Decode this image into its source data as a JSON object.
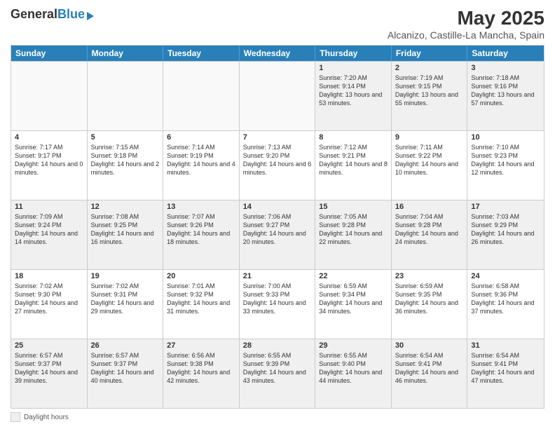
{
  "header": {
    "logo_general": "General",
    "logo_blue": "Blue",
    "title": "May 2025",
    "subtitle": "Alcanizo, Castille-La Mancha, Spain"
  },
  "days_of_week": [
    "Sunday",
    "Monday",
    "Tuesday",
    "Wednesday",
    "Thursday",
    "Friday",
    "Saturday"
  ],
  "weeks": [
    [
      {
        "day": "",
        "empty": true
      },
      {
        "day": "",
        "empty": true
      },
      {
        "day": "",
        "empty": true
      },
      {
        "day": "",
        "empty": true
      },
      {
        "day": "1",
        "sunrise": "Sunrise: 7:20 AM",
        "sunset": "Sunset: 9:14 PM",
        "daylight": "Daylight: 13 hours and 53 minutes."
      },
      {
        "day": "2",
        "sunrise": "Sunrise: 7:19 AM",
        "sunset": "Sunset: 9:15 PM",
        "daylight": "Daylight: 13 hours and 55 minutes."
      },
      {
        "day": "3",
        "sunrise": "Sunrise: 7:18 AM",
        "sunset": "Sunset: 9:16 PM",
        "daylight": "Daylight: 13 hours and 57 minutes."
      }
    ],
    [
      {
        "day": "4",
        "sunrise": "Sunrise: 7:17 AM",
        "sunset": "Sunset: 9:17 PM",
        "daylight": "Daylight: 14 hours and 0 minutes."
      },
      {
        "day": "5",
        "sunrise": "Sunrise: 7:15 AM",
        "sunset": "Sunset: 9:18 PM",
        "daylight": "Daylight: 14 hours and 2 minutes."
      },
      {
        "day": "6",
        "sunrise": "Sunrise: 7:14 AM",
        "sunset": "Sunset: 9:19 PM",
        "daylight": "Daylight: 14 hours and 4 minutes."
      },
      {
        "day": "7",
        "sunrise": "Sunrise: 7:13 AM",
        "sunset": "Sunset: 9:20 PM",
        "daylight": "Daylight: 14 hours and 6 minutes."
      },
      {
        "day": "8",
        "sunrise": "Sunrise: 7:12 AM",
        "sunset": "Sunset: 9:21 PM",
        "daylight": "Daylight: 14 hours and 8 minutes."
      },
      {
        "day": "9",
        "sunrise": "Sunrise: 7:11 AM",
        "sunset": "Sunset: 9:22 PM",
        "daylight": "Daylight: 14 hours and 10 minutes."
      },
      {
        "day": "10",
        "sunrise": "Sunrise: 7:10 AM",
        "sunset": "Sunset: 9:23 PM",
        "daylight": "Daylight: 14 hours and 12 minutes."
      }
    ],
    [
      {
        "day": "11",
        "sunrise": "Sunrise: 7:09 AM",
        "sunset": "Sunset: 9:24 PM",
        "daylight": "Daylight: 14 hours and 14 minutes."
      },
      {
        "day": "12",
        "sunrise": "Sunrise: 7:08 AM",
        "sunset": "Sunset: 9:25 PM",
        "daylight": "Daylight: 14 hours and 16 minutes."
      },
      {
        "day": "13",
        "sunrise": "Sunrise: 7:07 AM",
        "sunset": "Sunset: 9:26 PM",
        "daylight": "Daylight: 14 hours and 18 minutes."
      },
      {
        "day": "14",
        "sunrise": "Sunrise: 7:06 AM",
        "sunset": "Sunset: 9:27 PM",
        "daylight": "Daylight: 14 hours and 20 minutes."
      },
      {
        "day": "15",
        "sunrise": "Sunrise: 7:05 AM",
        "sunset": "Sunset: 9:28 PM",
        "daylight": "Daylight: 14 hours and 22 minutes."
      },
      {
        "day": "16",
        "sunrise": "Sunrise: 7:04 AM",
        "sunset": "Sunset: 9:28 PM",
        "daylight": "Daylight: 14 hours and 24 minutes."
      },
      {
        "day": "17",
        "sunrise": "Sunrise: 7:03 AM",
        "sunset": "Sunset: 9:29 PM",
        "daylight": "Daylight: 14 hours and 26 minutes."
      }
    ],
    [
      {
        "day": "18",
        "sunrise": "Sunrise: 7:02 AM",
        "sunset": "Sunset: 9:30 PM",
        "daylight": "Daylight: 14 hours and 27 minutes."
      },
      {
        "day": "19",
        "sunrise": "Sunrise: 7:02 AM",
        "sunset": "Sunset: 9:31 PM",
        "daylight": "Daylight: 14 hours and 29 minutes."
      },
      {
        "day": "20",
        "sunrise": "Sunrise: 7:01 AM",
        "sunset": "Sunset: 9:32 PM",
        "daylight": "Daylight: 14 hours and 31 minutes."
      },
      {
        "day": "21",
        "sunrise": "Sunrise: 7:00 AM",
        "sunset": "Sunset: 9:33 PM",
        "daylight": "Daylight: 14 hours and 33 minutes."
      },
      {
        "day": "22",
        "sunrise": "Sunrise: 6:59 AM",
        "sunset": "Sunset: 9:34 PM",
        "daylight": "Daylight: 14 hours and 34 minutes."
      },
      {
        "day": "23",
        "sunrise": "Sunrise: 6:59 AM",
        "sunset": "Sunset: 9:35 PM",
        "daylight": "Daylight: 14 hours and 36 minutes."
      },
      {
        "day": "24",
        "sunrise": "Sunrise: 6:58 AM",
        "sunset": "Sunset: 9:36 PM",
        "daylight": "Daylight: 14 hours and 37 minutes."
      }
    ],
    [
      {
        "day": "25",
        "sunrise": "Sunrise: 6:57 AM",
        "sunset": "Sunset: 9:37 PM",
        "daylight": "Daylight: 14 hours and 39 minutes."
      },
      {
        "day": "26",
        "sunrise": "Sunrise: 6:57 AM",
        "sunset": "Sunset: 9:37 PM",
        "daylight": "Daylight: 14 hours and 40 minutes."
      },
      {
        "day": "27",
        "sunrise": "Sunrise: 6:56 AM",
        "sunset": "Sunset: 9:38 PM",
        "daylight": "Daylight: 14 hours and 42 minutes."
      },
      {
        "day": "28",
        "sunrise": "Sunrise: 6:55 AM",
        "sunset": "Sunset: 9:39 PM",
        "daylight": "Daylight: 14 hours and 43 minutes."
      },
      {
        "day": "29",
        "sunrise": "Sunrise: 6:55 AM",
        "sunset": "Sunset: 9:40 PM",
        "daylight": "Daylight: 14 hours and 44 minutes."
      },
      {
        "day": "30",
        "sunrise": "Sunrise: 6:54 AM",
        "sunset": "Sunset: 9:41 PM",
        "daylight": "Daylight: 14 hours and 46 minutes."
      },
      {
        "day": "31",
        "sunrise": "Sunrise: 6:54 AM",
        "sunset": "Sunset: 9:41 PM",
        "daylight": "Daylight: 14 hours and 47 minutes."
      }
    ]
  ],
  "legend": {
    "label": "Daylight hours"
  }
}
